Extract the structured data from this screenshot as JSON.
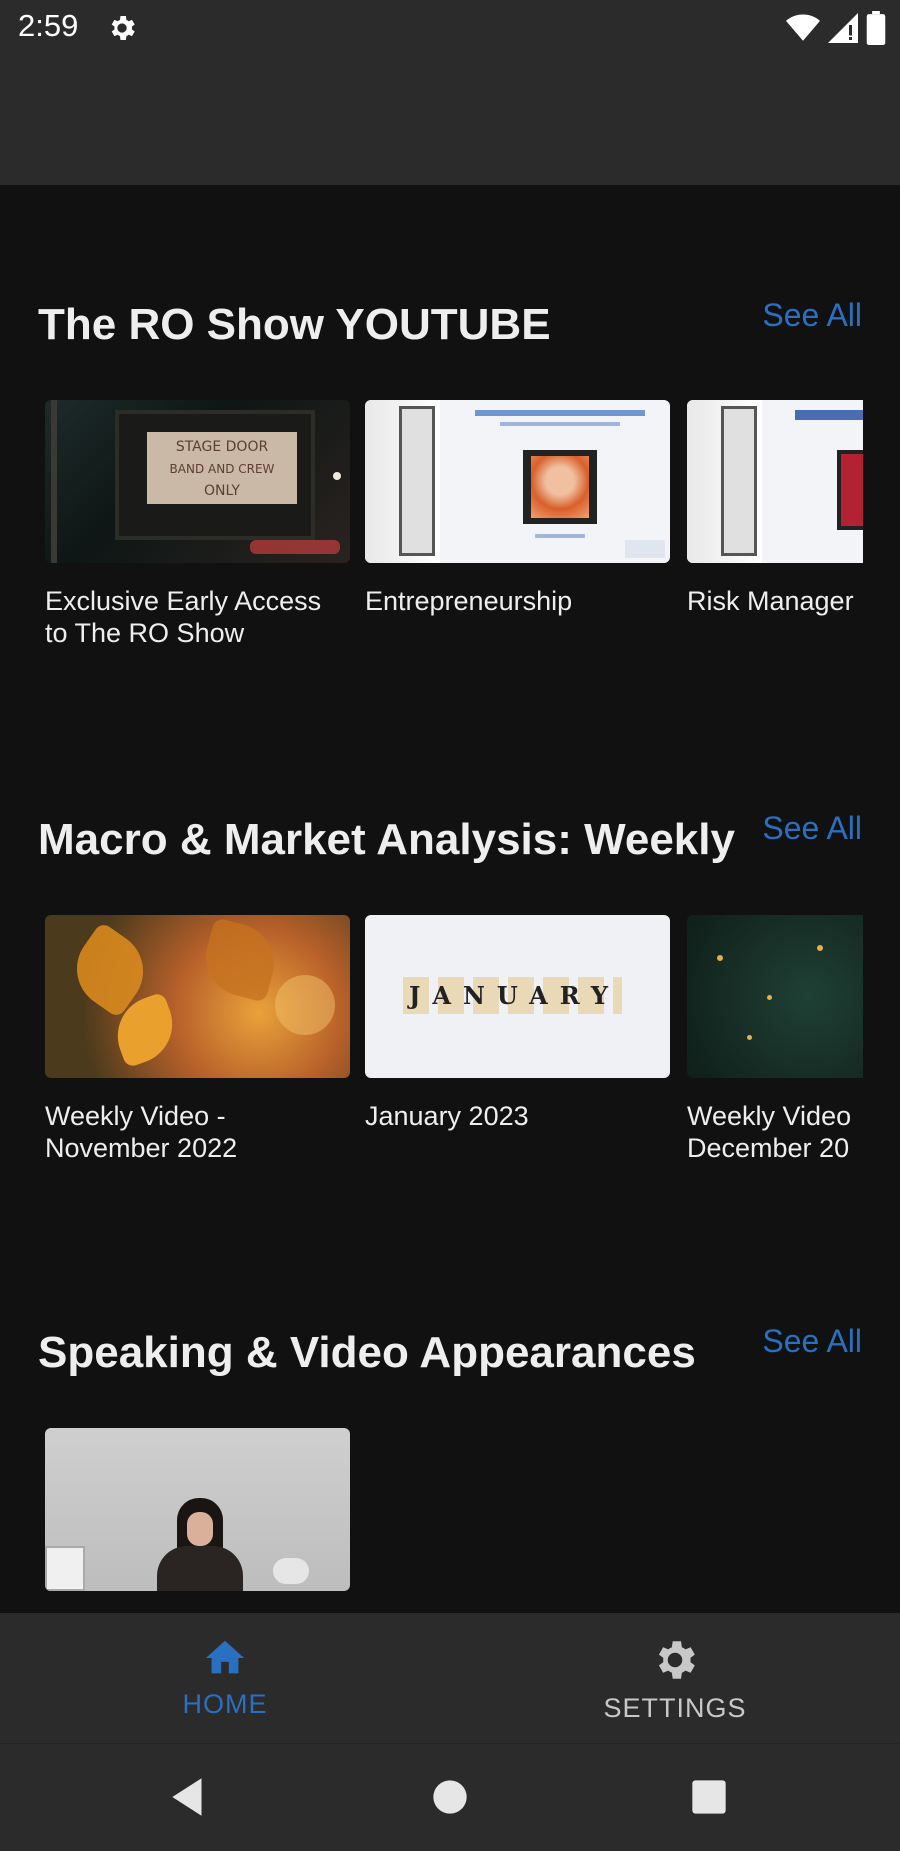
{
  "status_bar": {
    "time": "2:59",
    "icons": [
      "gear-icon",
      "wifi-icon",
      "signal-icon",
      "battery-icon"
    ]
  },
  "sections": [
    {
      "title": "The RO Show YOUTUBE",
      "see_all": "See All",
      "items": [
        {
          "title_line1": "Exclusive Early Access",
          "title_line2": "to The RO Show",
          "thumb_text": [
            "STAGE DOOR",
            "BAND AND CREW",
            "ONLY"
          ]
        },
        {
          "title_line1": "Entrepreneurship",
          "title_line2": ""
        },
        {
          "title_line1": "Risk Manager",
          "title_line2": ""
        }
      ]
    },
    {
      "title": "Macro & Market Analysis: Weekly",
      "see_all": "See All",
      "items": [
        {
          "title_line1": "Weekly Video -",
          "title_line2": "November 2022"
        },
        {
          "title_line1": "January 2023",
          "title_line2": "",
          "thumb_text": "JANUARY"
        },
        {
          "title_line1": "Weekly Video",
          "title_line2": "December 20"
        }
      ]
    },
    {
      "title": "Speaking & Video Appearances",
      "see_all": "See All",
      "items": []
    }
  ],
  "bottom_nav": {
    "home_label": "HOME",
    "settings_label": "SETTINGS",
    "active": "home"
  },
  "colors": {
    "accent": "#2a6fc0",
    "background": "#111111",
    "bar": "#2b2b2b"
  }
}
